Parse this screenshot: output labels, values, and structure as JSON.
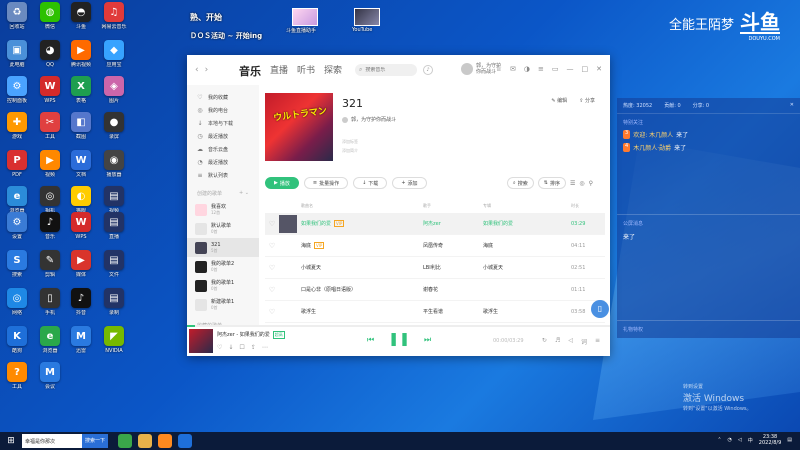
{
  "desktop": {
    "icons": [
      {
        "label": "回收站",
        "icon": "recycle-bin-icon",
        "color": "#6a8ac0",
        "glyph": "♻"
      },
      {
        "label": "微信",
        "icon": "wechat-icon",
        "color": "#2dc100",
        "glyph": "◍"
      },
      {
        "label": "斗鱼",
        "icon": "douyu-icon",
        "color": "#222222",
        "glyph": "◓"
      },
      {
        "label": "网易云音乐",
        "icon": "netease-icon",
        "color": "#e03a3a",
        "glyph": "♫"
      },
      {
        "label": "此电脑",
        "icon": "computer-icon",
        "color": "#4a90d9",
        "glyph": "▣"
      },
      {
        "label": "QQ",
        "icon": "qq-icon",
        "color": "#222222",
        "glyph": "◕"
      },
      {
        "label": "腾讯视频",
        "icon": "tencent-video-icon",
        "color": "#ff6a00",
        "glyph": "▶"
      },
      {
        "label": "应用宝",
        "icon": "app-store-icon",
        "color": "#37a3ff",
        "glyph": "◆"
      },
      {
        "label": "控制面板",
        "icon": "control-panel-icon",
        "color": "#4aa3ff",
        "glyph": "⚙"
      },
      {
        "label": "WPS",
        "icon": "wps-icon",
        "color": "#d42a2a",
        "glyph": "W"
      },
      {
        "label": "表格",
        "icon": "sheet-icon",
        "color": "#1e9e4f",
        "glyph": "X"
      },
      {
        "label": "图片",
        "icon": "image-icon",
        "color": "#cc66aa",
        "glyph": "◈"
      },
      {
        "label": "游戏",
        "icon": "game-icon",
        "color": "#ff9900",
        "glyph": "✚"
      },
      {
        "label": "工具",
        "icon": "tool-icon",
        "color": "#e04040",
        "glyph": "✂"
      },
      {
        "label": "截图",
        "icon": "screenshot-icon",
        "color": "#5577cc",
        "glyph": "◧"
      },
      {
        "label": "录屏",
        "icon": "record-icon",
        "color": "#333333",
        "glyph": "●"
      },
      {
        "label": "PDF",
        "icon": "pdf-icon",
        "color": "#d93030",
        "glyph": "P"
      },
      {
        "label": "视频",
        "icon": "video-icon",
        "color": "#ff8800",
        "glyph": "▶"
      },
      {
        "label": "文档",
        "icon": "doc-icon",
        "color": "#2b6cd9",
        "glyph": "W"
      },
      {
        "label": "播放器",
        "icon": "player-icon",
        "color": "#444444",
        "glyph": "◉"
      },
      {
        "label": "浏览器",
        "icon": "browser-icon",
        "color": "#2b8cd9",
        "glyph": "e"
      },
      {
        "label": "相机",
        "icon": "camera-icon",
        "color": "#333333",
        "glyph": "◎"
      },
      {
        "label": "猫眼",
        "icon": "cat-icon",
        "color": "#ffcc00",
        "glyph": "◐"
      },
      {
        "label": "视频",
        "icon": "video-2-icon",
        "color": "#223366",
        "glyph": "▤"
      },
      {
        "label": "设置",
        "icon": "settings-icon",
        "color": "#3a7bd5",
        "glyph": "⚙"
      },
      {
        "label": "音乐",
        "icon": "music-icon",
        "color": "#111111",
        "glyph": "♪"
      },
      {
        "label": "WPS",
        "icon": "wps-2-icon",
        "color": "#d42a2a",
        "glyph": "W"
      },
      {
        "label": "直播",
        "icon": "live-icon",
        "color": "#223366",
        "glyph": "▤"
      },
      {
        "label": "搜索",
        "icon": "search-app-icon",
        "color": "#2a7ae0",
        "glyph": "S"
      },
      {
        "label": "剪辑",
        "icon": "edit-icon",
        "color": "#333333",
        "glyph": "✎"
      },
      {
        "label": "媒体",
        "icon": "media-icon",
        "color": "#d9342b",
        "glyph": "▶"
      },
      {
        "label": "文件",
        "icon": "file-icon",
        "color": "#223366",
        "glyph": "▤"
      },
      {
        "label": "网络",
        "icon": "network-icon",
        "color": "#1e88e5",
        "glyph": "◎"
      },
      {
        "label": "手机",
        "icon": "phone-icon",
        "color": "#333333",
        "glyph": "▯"
      },
      {
        "label": "抖音",
        "icon": "douyin-icon",
        "color": "#111111",
        "glyph": "♪"
      },
      {
        "label": "录制",
        "icon": "rec-icon",
        "color": "#223366",
        "glyph": "▤"
      },
      {
        "label": "酷狗",
        "icon": "kugou-icon",
        "color": "#1e6fd9",
        "glyph": "K"
      },
      {
        "label": "浏览器",
        "icon": "ie-icon",
        "color": "#2aa84a",
        "glyph": "e"
      },
      {
        "label": "迅雷",
        "icon": "thunder-icon",
        "color": "#2a7ae0",
        "glyph": "M"
      },
      {
        "label": "NVIDIA",
        "icon": "nvidia-icon",
        "color": "#76b900",
        "glyph": "◤"
      },
      {
        "label": "工具",
        "icon": "tool-2-icon",
        "color": "#ff8a00",
        "glyph": "?"
      },
      {
        "label": "会议",
        "icon": "meeting-icon",
        "color": "#2a7ae0",
        "glyph": "M"
      }
    ],
    "top_title": "熟、开始",
    "top_sub": "ＤＯＳ活动 ~ 开始ing",
    "thumb1_label": "斗鱼直播助手",
    "thumb2_label": "YouTube"
  },
  "watermark": {
    "text": "全能王陌梦",
    "logo": "斗鱼",
    "sub": "DOUYU.COM"
  },
  "overlay": {
    "head": [
      "热度: 32052",
      "贡献: 0",
      "分享: 0"
    ],
    "section_title": "特别关注",
    "lines": [
      {
        "badge": "3",
        "user": "欢迎: 木几颜人",
        "msg": "来了"
      },
      {
        "badge": "4",
        "user": "木几颜人·勋爵",
        "msg": "来了"
      }
    ],
    "fans_title": "公屏消息",
    "fans_line": "来了",
    "gift_title": "礼物特权"
  },
  "activate": {
    "line1": "转到设置",
    "line2": "激活 Windows",
    "line3": "转到\"设置\"以激活 Windows。"
  },
  "app": {
    "tabs": [
      "音乐",
      "直播",
      "听书",
      "探索"
    ],
    "search_placeholder": "搜索音乐",
    "username": "郭，为守护",
    "user_sub": "你而战斗",
    "sidebar_items": [
      {
        "label": "我的收藏",
        "icon": "heart-icon",
        "glyph": "♡"
      },
      {
        "label": "我的电台",
        "icon": "radio-icon",
        "glyph": "◎"
      },
      {
        "label": "本地与下载",
        "icon": "download-icon",
        "glyph": "↓"
      },
      {
        "label": "最近播放",
        "icon": "recent-icon",
        "glyph": "◷"
      },
      {
        "label": "音乐云盘",
        "icon": "cloud-icon",
        "glyph": "☁"
      },
      {
        "label": "最近播放",
        "icon": "clock-icon",
        "glyph": "◔"
      },
      {
        "label": "默认列表",
        "icon": "list-icon",
        "glyph": "≡"
      }
    ],
    "created_section": "创建的歌单",
    "playlists": [
      {
        "name": "我喜欢",
        "count": "12首",
        "color": "#ffd6e0"
      },
      {
        "name": "默认歌单",
        "count": "0首",
        "color": "#e5e5e5"
      },
      {
        "name": "321",
        "count": "5首",
        "color": "#444455"
      },
      {
        "name": "我的歌单2",
        "count": "0首",
        "color": "#222222"
      },
      {
        "name": "我的歌单1",
        "count": "0首",
        "color": "#222222"
      },
      {
        "name": "新建歌单1",
        "count": "0首",
        "color": "#e5e5e5"
      }
    ],
    "collected_section": "收藏的歌单",
    "playlist": {
      "title": "321",
      "creator": "郭，为守护你而战斗",
      "desc1": "添加标签",
      "desc2": "添加简介",
      "edit_label": "编辑",
      "share_label": "分享",
      "cover_text": "ウルトラマン"
    },
    "actions": [
      {
        "label": "播放",
        "primary": true,
        "icon": "play-icon",
        "glyph": "▶"
      },
      {
        "label": "批量操作",
        "primary": false,
        "icon": "batch-icon",
        "glyph": "≡"
      },
      {
        "label": "下载",
        "primary": false,
        "icon": "download-2-icon",
        "glyph": "↓"
      },
      {
        "label": "添加",
        "primary": false,
        "icon": "add-icon",
        "glyph": "+"
      }
    ],
    "right_actions": [
      {
        "label": "搜索",
        "icon": "search-icon",
        "glyph": "⌕"
      },
      {
        "label": "排序",
        "icon": "sort-icon",
        "glyph": "⇅"
      }
    ],
    "columns": [
      "歌曲名",
      "歌手",
      "专辑",
      "时长"
    ],
    "songs": [
      {
        "title": "如果我们的爱",
        "vip": true,
        "artist": "阿杰zer",
        "album": "如果我们的爱",
        "duration": "03:29",
        "playing": true
      },
      {
        "title": "海底",
        "vip": true,
        "artist": "凤凰传奇",
        "album": "海底",
        "duration": "04:11",
        "playing": false
      },
      {
        "title": "小城夏天",
        "vip": false,
        "artist": "LBI利比",
        "album": "小城夏天",
        "duration": "02:51",
        "playing": false
      },
      {
        "title": "口是心非（原唱日语版）",
        "vip": false,
        "artist": "谢春花",
        "album": "",
        "duration": "01:11",
        "playing": false
      },
      {
        "title": "歌浮生",
        "vip": false,
        "artist": "平生看谱",
        "album": "歌浮生",
        "duration": "03:58",
        "playing": false
      }
    ],
    "player": {
      "title": "阿杰zer - 如果我们的爱",
      "quality": "超高",
      "time": "00:00/03:29",
      "progress": 0.02
    }
  },
  "taskbar": {
    "search_text": "幸福是你那次",
    "search_btn": "搜索一下",
    "time": "23:38",
    "date": "2022/8/9"
  }
}
